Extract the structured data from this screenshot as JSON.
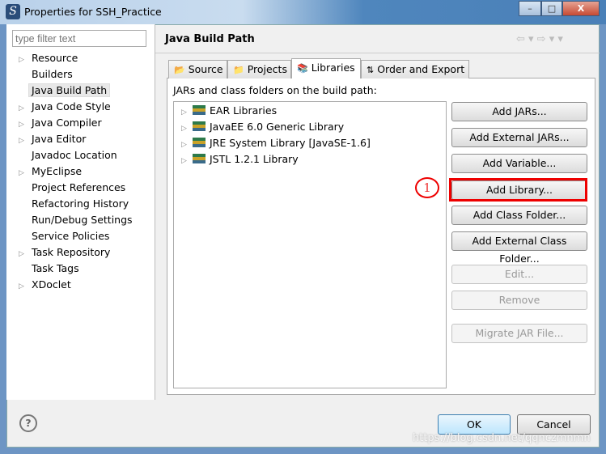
{
  "window": {
    "title": "Properties for SSH_Practice",
    "minimize": "–",
    "maximize": "□",
    "close": "X"
  },
  "sidebar": {
    "filter_placeholder": "type filter text",
    "items": [
      {
        "label": "Resource",
        "expandable": true
      },
      {
        "label": "Builders",
        "expandable": false
      },
      {
        "label": "Java Build Path",
        "expandable": false,
        "selected": true
      },
      {
        "label": "Java Code Style",
        "expandable": true
      },
      {
        "label": "Java Compiler",
        "expandable": true
      },
      {
        "label": "Java Editor",
        "expandable": true
      },
      {
        "label": "Javadoc Location",
        "expandable": false
      },
      {
        "label": "MyEclipse",
        "expandable": true
      },
      {
        "label": "Project References",
        "expandable": false
      },
      {
        "label": "Refactoring History",
        "expandable": false
      },
      {
        "label": "Run/Debug Settings",
        "expandable": false
      },
      {
        "label": "Service Policies",
        "expandable": false
      },
      {
        "label": "Task Repository",
        "expandable": true
      },
      {
        "label": "Task Tags",
        "expandable": false
      },
      {
        "label": "XDoclet",
        "expandable": true
      }
    ]
  },
  "header": {
    "title": "Java Build Path",
    "nav": "⇦ ▾ ⇨ ▾ ▾"
  },
  "tabs": [
    {
      "label": "Source",
      "icon": "📂"
    },
    {
      "label": "Projects",
      "icon": "📁"
    },
    {
      "label": "Libraries",
      "icon": "📚",
      "active": true
    },
    {
      "label": "Order and Export",
      "icon": "⇅"
    }
  ],
  "panel": {
    "caption": "JARs and class folders on the build path:",
    "libraries": [
      "EAR Libraries",
      "JavaEE 6.0 Generic Library",
      "JRE System Library [JavaSE-1.6]",
      "JSTL 1.2.1 Library"
    ],
    "buttons": [
      {
        "label": "Add JARs...",
        "enabled": true
      },
      {
        "label": "Add External JARs...",
        "enabled": true
      },
      {
        "label": "Add Variable...",
        "enabled": true
      },
      {
        "label": "Add Library...",
        "enabled": true,
        "highlighted": true
      },
      {
        "label": "Add Class Folder...",
        "enabled": true
      },
      {
        "label": "Add External Class Folder...",
        "enabled": true
      },
      {
        "label": "Edit...",
        "enabled": false
      },
      {
        "label": "Remove",
        "enabled": false
      },
      {
        "label": "Migrate JAR File...",
        "enabled": false
      }
    ]
  },
  "annotation": {
    "label": "1",
    "color": "#ee0000"
  },
  "footer": {
    "help": "?",
    "ok": "OK",
    "cancel": "Cancel"
  },
  "watermark": "https://blog.csdn.net/qqnczmnmn"
}
